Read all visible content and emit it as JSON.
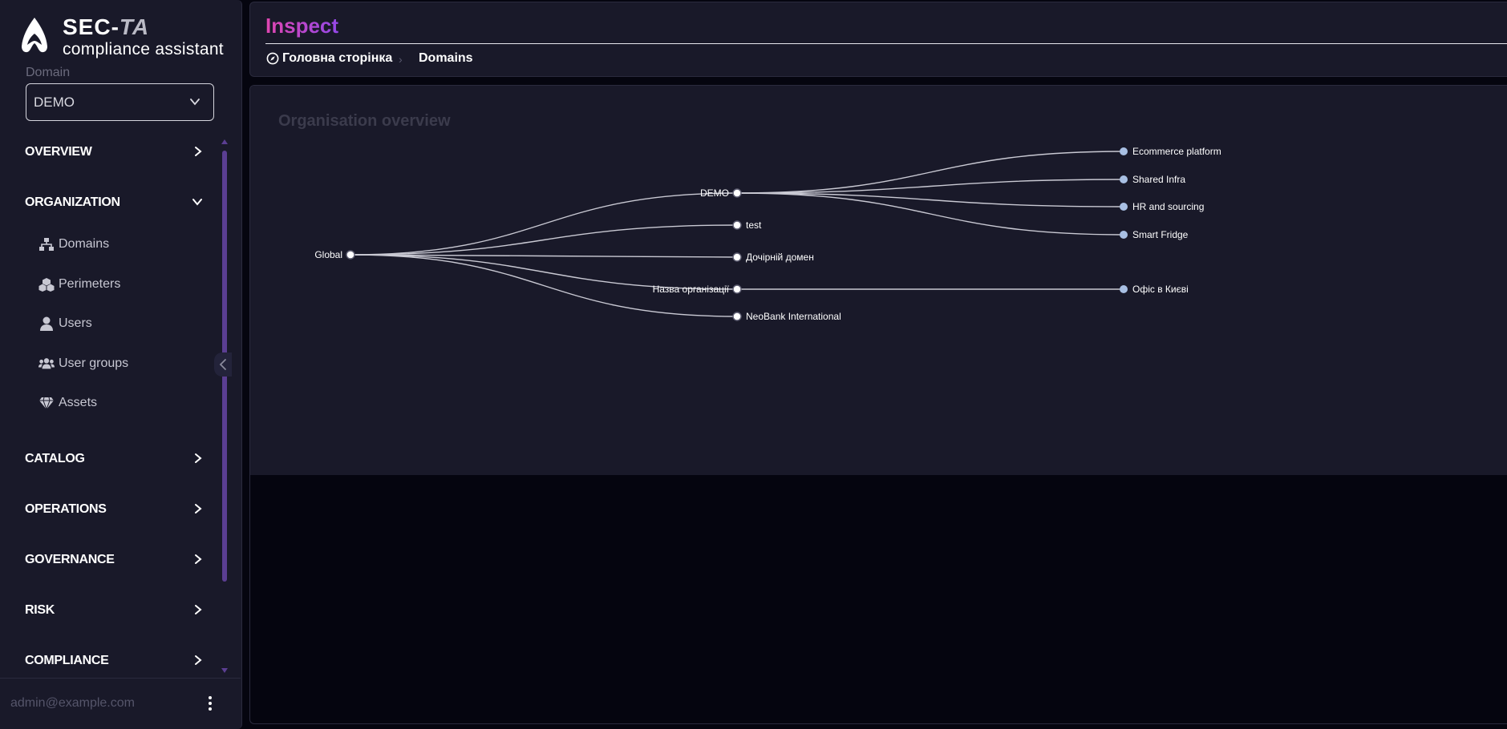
{
  "app": {
    "brand_main": "SEC-",
    "brand_accent": "TA",
    "brand_subtitle": "compliance assistant"
  },
  "sidebar": {
    "domain_label": "Domain",
    "domain_value": "DEMO",
    "sections": {
      "overview": "OVERVIEW",
      "organization": "ORGANIZATION",
      "catalog": "CATALOG",
      "operations": "OPERATIONS",
      "governance": "GOVERNANCE",
      "risk": "RISK",
      "compliance": "COMPLIANCE"
    },
    "organization_items": {
      "domains": "Domains",
      "perimeters": "Perimeters",
      "users": "Users",
      "user_groups": "User groups",
      "assets": "Assets"
    },
    "user_email": "admin@example.com"
  },
  "header": {
    "title": "Inspect",
    "breadcrumb_home": "Головна сторінка",
    "breadcrumb_separator": "›",
    "breadcrumb_current": "Domains"
  },
  "main": {
    "card_title": "Organisation overview",
    "tree": {
      "root": "Global",
      "level1": [
        "DEMO",
        "test",
        "Дочірній домен",
        "Назва організації",
        "NeoBank International"
      ],
      "demo_children": [
        "Ecommerce platform",
        "Shared Infra",
        "HR and sourcing",
        "Smart Fridge"
      ],
      "org_children": [
        "Офіс в Києві"
      ]
    }
  },
  "colors": {
    "accent_pink": "#e046b0",
    "accent_purple": "#9448e8",
    "sidebar_bg": "#191929",
    "leaf_node": "#a8bfe3"
  }
}
